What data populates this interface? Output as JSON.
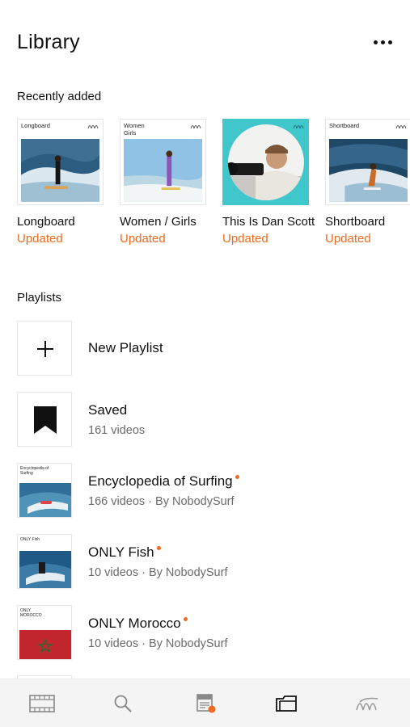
{
  "header": {
    "title": "Library",
    "more_icon": "more-horizontal-icon"
  },
  "recent": {
    "section_title": "Recently added",
    "items": [
      {
        "thumb_label": "Longboard",
        "name": "Longboard",
        "status": "Updated"
      },
      {
        "thumb_label": "Women\nGirls",
        "name": "Women / Girls",
        "status": "Updated"
      },
      {
        "thumb_label": "",
        "name": "This Is Dan Scott",
        "status": "Updated"
      },
      {
        "thumb_label": "Shortboard",
        "name": "Shortboard",
        "status": "Updated"
      }
    ]
  },
  "playlists": {
    "section_title": "Playlists",
    "new_playlist": {
      "title": "New Playlist"
    },
    "saved": {
      "title": "Saved",
      "sub": "161 videos"
    },
    "items": [
      {
        "thumb_label": "Encyclopedia of Surfing",
        "title": "Encyclopedia of Surfing",
        "sub": "166 videos · By NobodySurf",
        "is_new": true
      },
      {
        "thumb_label": "ONLY Fish",
        "title": "ONLY Fish",
        "sub": "10 videos · By NobodySurf",
        "is_new": true
      },
      {
        "thumb_label": "ONLY MOROCCO",
        "title": "ONLY Morocco",
        "sub": "10 videos · By NobodySurf",
        "is_new": true
      }
    ]
  },
  "tabbar": {
    "tabs": [
      {
        "icon": "film-strip-icon",
        "active": false
      },
      {
        "icon": "search-icon",
        "active": false
      },
      {
        "icon": "feed-icon",
        "active": false
      },
      {
        "icon": "library-folder-icon",
        "active": true
      },
      {
        "icon": "nobodysurf-logo-icon",
        "active": false
      }
    ]
  },
  "colors": {
    "accent": "#f06a1d",
    "text": "#111111",
    "muted": "#6b6b6b",
    "tabbar_bg": "#f4f4f4"
  }
}
